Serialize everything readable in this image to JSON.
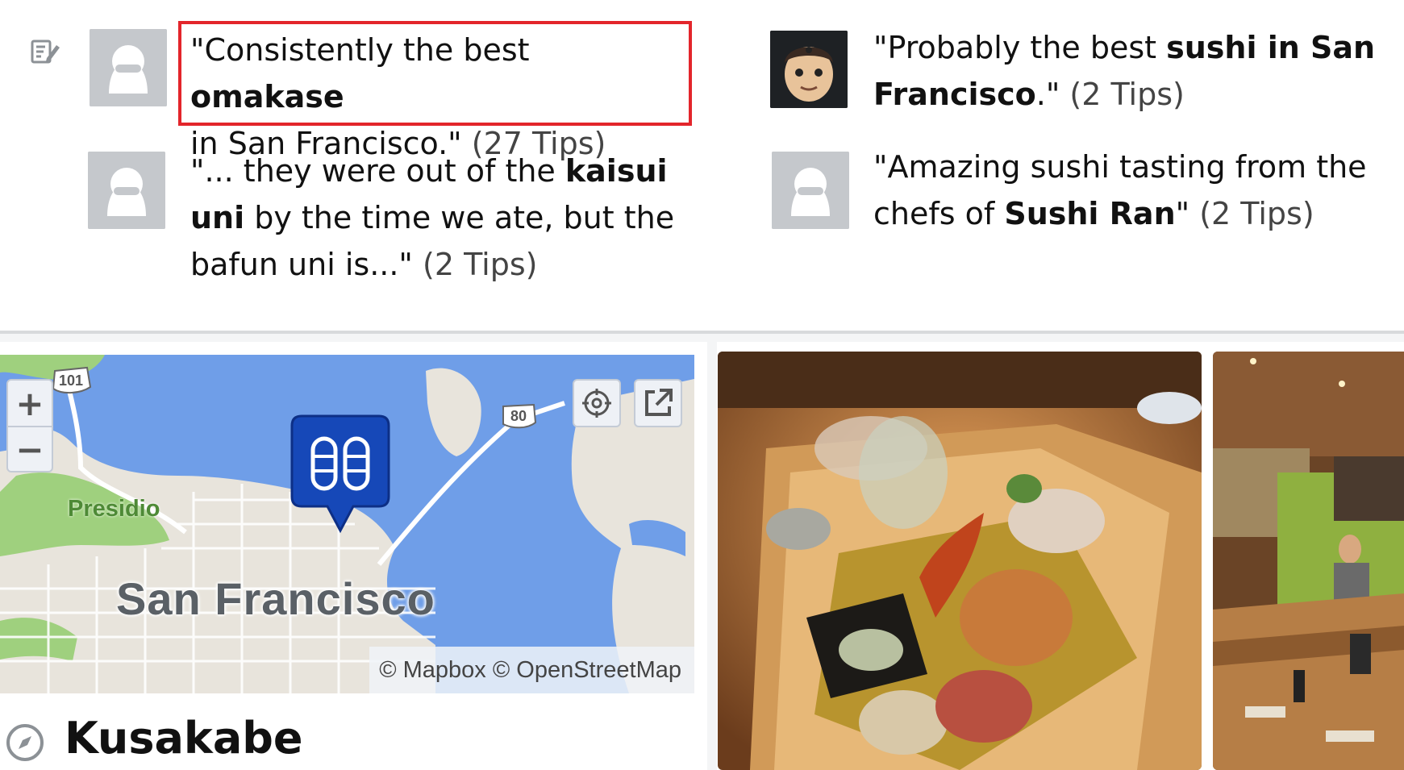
{
  "tips": [
    {
      "before": "\"Consistently the best ",
      "bold": "omakase",
      "after": "",
      "line2": "in San Francisco.\"",
      "count": "(27 Tips)"
    },
    {
      "before": "\"Probably the best ",
      "bold": "sushi in San",
      "bold2": "Francisco",
      "after": ".\"",
      "count": "(2 Tips)"
    },
    {
      "before": "\"... they were out of the ",
      "bold": "kaisui",
      "bold2": "uni",
      "after": " by the time we ate, but the",
      "line3": "bafun uni is...\"",
      "count": "(2 Tips)"
    },
    {
      "before": "\"Amazing sushi tasting from the",
      "line2a": "chefs of ",
      "bold": "Sushi Ran",
      "after": "\"",
      "count": "(2 Tips)"
    }
  ],
  "map": {
    "zoom_in": "+",
    "zoom_out": "−",
    "city": "San Francisco",
    "park": "Presidio",
    "highway_101": "101",
    "highway_80": "80",
    "attribution": "© Mapbox © OpenStreetMap",
    "colors": {
      "water": "#6f9ee8",
      "land": "#e8e4dc",
      "park": "#9fd07e",
      "pin": "#1648b8"
    }
  },
  "place": {
    "name": "Kusakabe"
  },
  "icons": [
    "edit-icon",
    "user-avatar-icon",
    "locate-icon",
    "external-link-icon",
    "sushi-pin-icon",
    "compass-icon"
  ]
}
